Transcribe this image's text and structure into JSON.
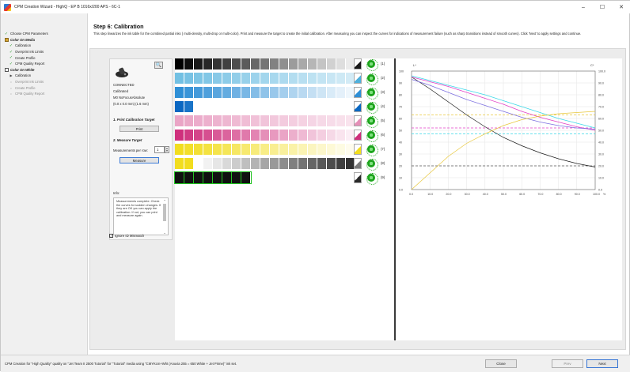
{
  "window": {
    "title": "CPM Creation Wizard - HighQ - EP B 1016x/200 APS - 6C-1",
    "minimize": "–",
    "maximize": "☐",
    "close": "✕"
  },
  "sidebar": {
    "items": [
      {
        "label": "Choose CPM Parameters",
        "state": "done",
        "level": 0
      },
      {
        "label": "Color On Media",
        "state": "group",
        "level": 0
      },
      {
        "label": "Calibration",
        "state": "done",
        "level": 1
      },
      {
        "label": "Overprint Ink Limits",
        "state": "done",
        "level": 1
      },
      {
        "label": "Create Profile",
        "state": "done",
        "level": 1
      },
      {
        "label": "CPM Quality Report",
        "state": "done",
        "level": 1
      },
      {
        "label": "Color On White",
        "state": "group-box",
        "level": 0
      },
      {
        "label": "Calibration",
        "state": "current",
        "level": 1
      },
      {
        "label": "Overprint Ink Limits",
        "state": "pending",
        "level": 1
      },
      {
        "label": "Create Profile",
        "state": "pending",
        "level": 1
      },
      {
        "label": "CPM Quality Report",
        "state": "pending",
        "level": 1
      }
    ]
  },
  "step": {
    "title": "Step 6: Calibration",
    "description": "This step linearizes the ink table for the combined partial inks ( multi-density, multi-drop or multi-color). Print and measure the target to create the initial calibration. After measuring you can inspect the curves for indications of measurement failure (such as sharp transitions instead of smooth curves). Click 'Next' to apply settings and continue."
  },
  "control": {
    "status_connected": "CONNECTED",
    "status_calibrated": "Calibrated",
    "device_mode": "M0 NoFocusAbsolute",
    "aperture": "(0.0 x 0.0 mm) (1.6 mm)",
    "print_section": "1. Print Calibration Target",
    "print_label": "Print",
    "measure_section": "2. Measure Target",
    "measurements_label": "Measurements per row:",
    "measurements_value": "1",
    "measure_label": "Measure",
    "info_label": "Info:",
    "info_text": "Measurements complete. Check the curves for sudden changes. If they are OK you can apply the calibration. If not, you can print and measure again.",
    "ignore_label": "Ignore ID Mismatch",
    "ignore_checked": true
  },
  "targets": {
    "rows": [
      {
        "num": "(1)",
        "color": "#1a1a1a",
        "ramp": "black"
      },
      {
        "num": "(2)",
        "color": "#4fb0dc",
        "ramp": "lightcyan"
      },
      {
        "num": "(3)",
        "color": "#2f8fd6",
        "ramp": "cyan"
      },
      {
        "num": "(4)",
        "color": "#0a67c2",
        "ramp": "cyanshort"
      },
      {
        "num": "(5)",
        "color": "#e58fb8",
        "ramp": "lightmagenta"
      },
      {
        "num": "(6)",
        "color": "#cf2f7c",
        "ramp": "magenta"
      },
      {
        "num": "(7)",
        "color": "#f2dd1e",
        "ramp": "yellow"
      },
      {
        "num": "(8)",
        "color": "#7a7a7a",
        "ramp": "gray"
      },
      {
        "num": "(9)",
        "color": "#2a2a2a",
        "ramp": "blackpatch"
      }
    ]
  },
  "chart_data": {
    "type": "line",
    "x_ticks": [
      "0.0",
      "10.0",
      "20.0",
      "30.0",
      "40.0",
      "50.0",
      "60.0",
      "70.0",
      "80.0",
      "90.0",
      "100.0",
      "%"
    ],
    "y_left_ticks": [
      "100",
      "90",
      "80",
      "70",
      "60",
      "50",
      "40",
      "30",
      "20",
      "10",
      "0.0"
    ],
    "y_right_ticks": [
      "100.0",
      "90.0",
      "80.0",
      "70.0",
      "60.0",
      "50.0",
      "40.0",
      "30.0",
      "20.0",
      "10.0",
      "0.0"
    ],
    "left_axis_label": "L*",
    "right_axis_label": "C*",
    "xlim": [
      0,
      100
    ],
    "ylim": [
      0,
      100
    ],
    "series": [
      {
        "color": "#1a1a1a",
        "x": [
          0,
          10,
          20,
          30,
          40,
          50,
          60,
          70,
          80,
          90,
          100
        ],
        "y": [
          95,
          85,
          74,
          63,
          53,
          44,
          37,
          31,
          26,
          22,
          19
        ]
      },
      {
        "color": "#e23ec6",
        "x": [
          0,
          10,
          20,
          30,
          40,
          50,
          60,
          70,
          80,
          90,
          100
        ],
        "y": [
          95,
          91,
          87,
          82,
          77,
          72,
          66,
          61,
          57,
          53,
          50
        ]
      },
      {
        "color": "#3ad8e8",
        "x": [
          0,
          10,
          20,
          30,
          40,
          50,
          60,
          70,
          80,
          90,
          100
        ],
        "y": [
          96,
          92,
          88,
          84,
          80,
          75,
          70,
          65,
          60,
          56,
          52
        ]
      },
      {
        "color": "#7b6ee0",
        "x": [
          0,
          10,
          20,
          30,
          40,
          50,
          60,
          70,
          80,
          90,
          100
        ],
        "y": [
          93,
          88,
          82,
          76,
          71,
          66,
          61,
          57,
          54,
          52,
          51
        ]
      },
      {
        "color": "#e8c73a",
        "x": [
          0,
          10,
          20,
          30,
          40,
          50,
          60,
          70,
          80,
          90,
          100
        ],
        "y": [
          0,
          14,
          28,
          39,
          47,
          54,
          59,
          62,
          64,
          65,
          66
        ]
      }
    ],
    "reference_lines": [
      {
        "color": "#e8c73a",
        "y": 63
      },
      {
        "color": "#e23ec6",
        "y": 52
      },
      {
        "color": "#3ad8e8",
        "y": 47
      },
      {
        "color": "#555555",
        "y": 20
      }
    ],
    "grid": true
  },
  "footer": {
    "status": "CPM Creation for \"High Quality\" quality on \"Jet Team II 2500 Tutorial\" for \"Tutorial\" media using \"CMYKcm+Wht (Anuvia 255 = 650 White + Jet Prime)\" ink set.",
    "close_label": "Close",
    "prev_label": "Prev",
    "next_label": "Next"
  }
}
